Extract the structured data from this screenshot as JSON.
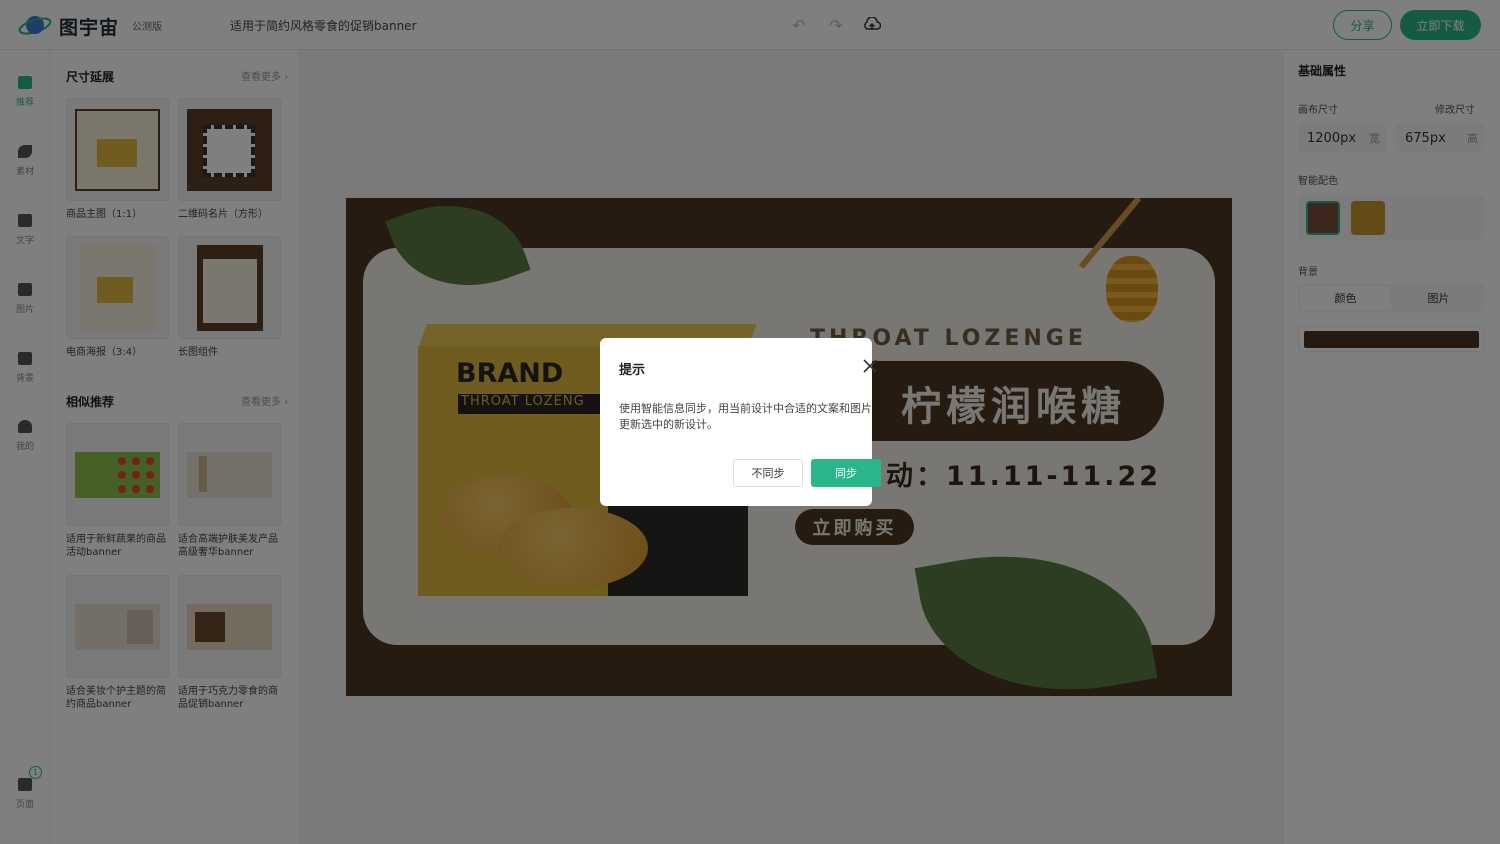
{
  "header": {
    "brand": "图宇宙",
    "badge": "公测版",
    "doc_title": "适用于简约风格零食的促销banner",
    "share_label": "分享",
    "download_label": "立即下载"
  },
  "rail": {
    "items": [
      {
        "label": "推荐",
        "icon": "recommend-icon",
        "active": true
      },
      {
        "label": "素材",
        "icon": "shapes-icon"
      },
      {
        "label": "文字",
        "icon": "text-icon"
      },
      {
        "label": "图片",
        "icon": "image-icon"
      },
      {
        "label": "背景",
        "icon": "background-icon"
      },
      {
        "label": "我的",
        "icon": "user-icon"
      }
    ],
    "pages_label": "页面",
    "pages_count": "1"
  },
  "panel": {
    "section1": {
      "title": "尺寸延展",
      "more": "查看更多",
      "items": [
        {
          "caption": "商品主图（1:1）"
        },
        {
          "caption": "二维码名片（方形）"
        },
        {
          "caption": "电商海报（3:4）"
        },
        {
          "caption": "长图组件"
        }
      ]
    },
    "section2": {
      "title": "相似推荐",
      "more": "查看更多",
      "items": [
        {
          "caption": "适用于新鲜蔬果的商品活动banner"
        },
        {
          "caption": "适合高端护肤美发产品高级奢华banner"
        },
        {
          "caption": "适合美妆个护主题的简约商品banner"
        },
        {
          "caption": "适用于巧克力零食的商品促销banner"
        }
      ]
    }
  },
  "right_panel": {
    "title": "基础属性",
    "canvas_size_label": "画布尺寸",
    "resize_label": "修改尺寸",
    "width_value": "1200px",
    "width_unit": "宽",
    "height_value": "675px",
    "height_unit": "高",
    "smart_color_label": "智能配色",
    "swatches": [
      "#7a4f3a",
      "#c9952c"
    ],
    "background_label": "背景",
    "tab_color": "颜色",
    "tab_image": "图片",
    "background_color": "#4c3520"
  },
  "banner": {
    "brand": "BRAND",
    "throat": "THROAT LOZENG",
    "en_title": "THROAT LOZENGE",
    "cn_title": "柠檬润喉糖",
    "date": "动：11.11-11.22",
    "buy": "立即购买"
  },
  "modal": {
    "title": "提示",
    "body": "使用智能信息同步，用当前设计中合适的文案和图片更新选中的新设计。",
    "cancel_label": "不同步",
    "ok_label": "同步"
  }
}
